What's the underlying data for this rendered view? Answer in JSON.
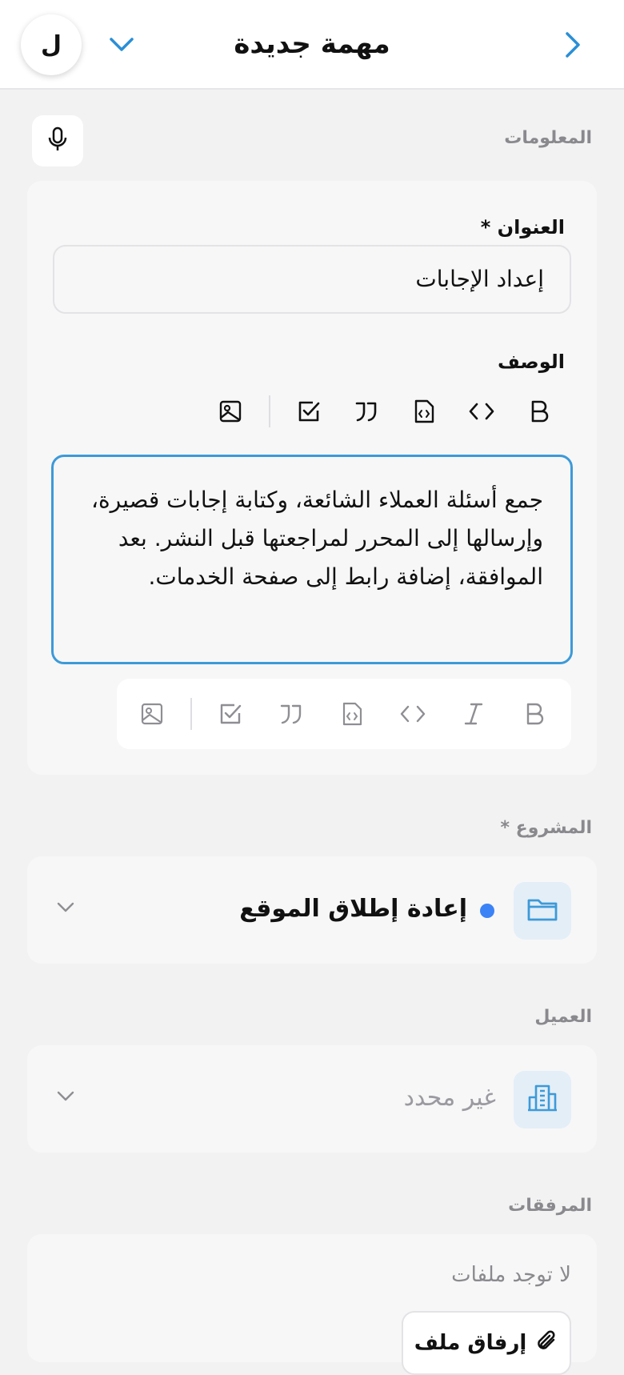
{
  "header": {
    "title": "مهمة جديدة",
    "avatar_letter": "ل",
    "back_icon": "chevron-right-icon",
    "dropdown_icon": "chevron-down-icon",
    "accent_color": "#2a8fd6"
  },
  "info_section": {
    "label": "المعلومات",
    "mic_icon": "microphone-icon"
  },
  "title_field": {
    "label": "العنوان *",
    "value": "إعداد الإجابات"
  },
  "description_field": {
    "label": "الوصف",
    "value": "جمع أسئلة العملاء الشائعة، وكتابة إجابات قصيرة، وإرسالها إلى المحرر لمراجعتها قبل النشر. بعد الموافقة، إضافة رابط إلى صفحة الخدمات.",
    "toolbar_top": [
      "bold-icon",
      "code-icon",
      "code-block-icon",
      "quote-icon",
      "checklist-icon",
      "image-icon"
    ],
    "toolbar_bottom": [
      "bold-icon",
      "italic-icon",
      "code-icon",
      "code-block-icon",
      "quote-icon",
      "checklist-icon",
      "image-icon"
    ]
  },
  "project": {
    "label": "المشروع *",
    "value": "إعادة إطلاق الموقع",
    "dot_color": "#3b82f6",
    "icon": "folder-icon"
  },
  "client": {
    "label": "العميل",
    "placeholder": "غير محدد",
    "icon": "building-icon"
  },
  "attachments": {
    "label": "المرفقات",
    "empty_text": "لا توجد ملفات",
    "attach_button": "إرفاق ملف",
    "attach_icon": "paperclip-icon"
  }
}
